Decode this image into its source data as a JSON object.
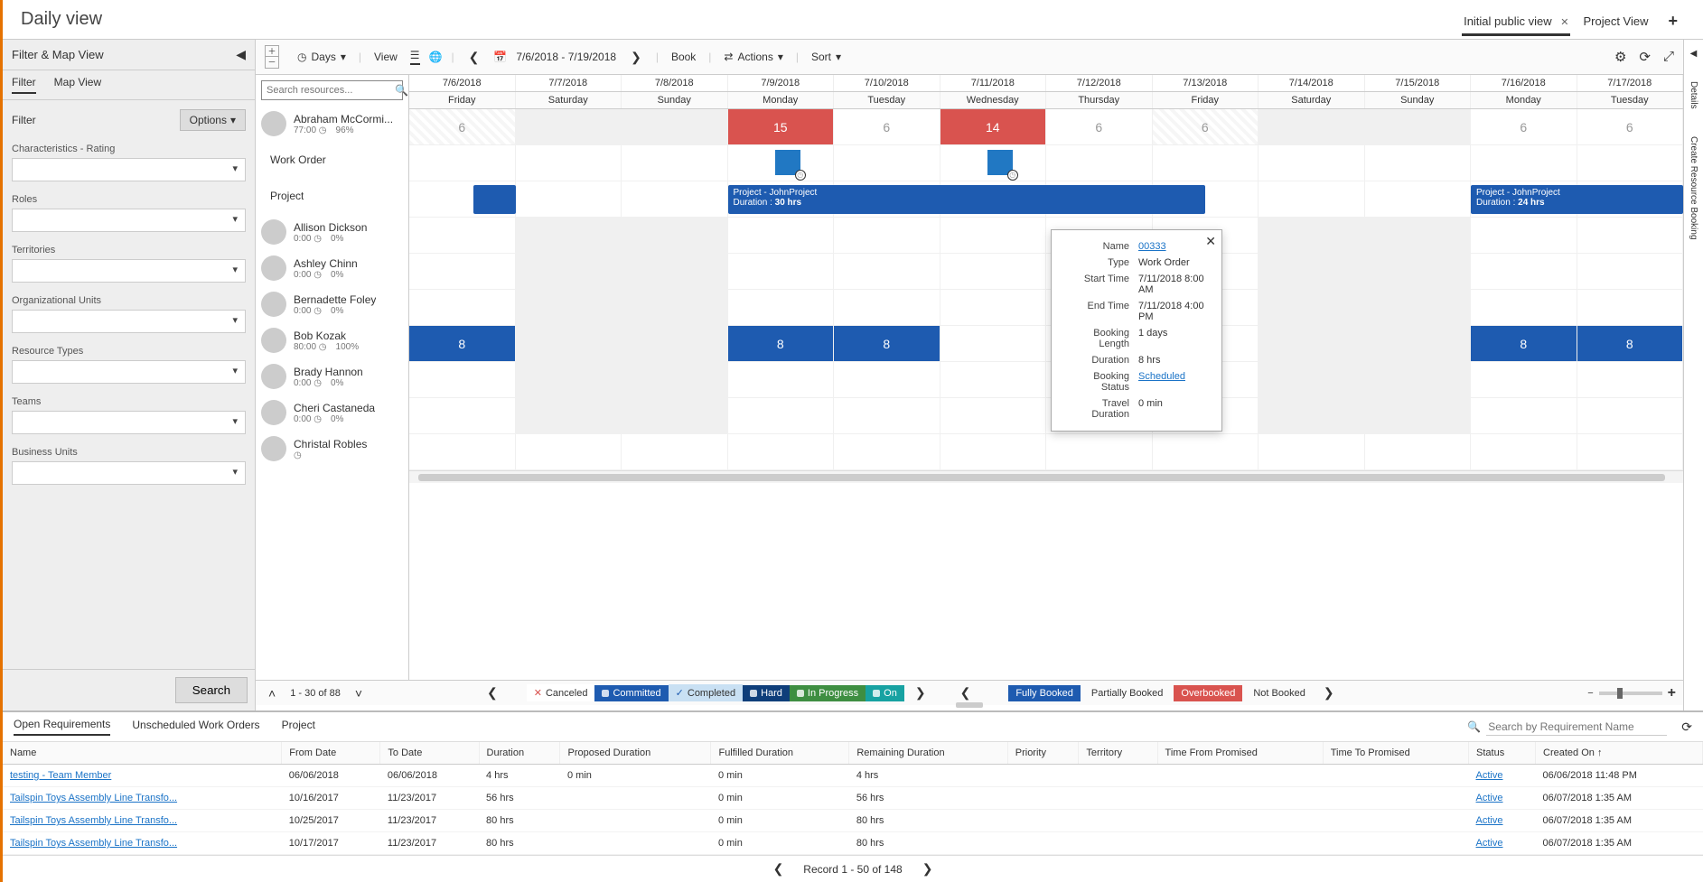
{
  "header": {
    "title": "Daily view",
    "view_tabs": [
      {
        "label": "Initial public view",
        "closable": true,
        "active": true
      },
      {
        "label": "Project View",
        "closable": false,
        "active": false
      }
    ]
  },
  "left_panel": {
    "title": "Filter & Map View",
    "tabs": [
      "Filter",
      "Map View"
    ],
    "active_tab": "Filter",
    "filter_header": "Filter",
    "options_label": "Options",
    "groups": [
      "Characteristics - Rating",
      "Roles",
      "Territories",
      "Organizational Units",
      "Resource Types",
      "Teams",
      "Business Units"
    ],
    "search_btn": "Search"
  },
  "toolbar": {
    "days": "Days",
    "view": "View",
    "date_range": "7/6/2018 - 7/19/2018",
    "book": "Book",
    "actions": "Actions",
    "sort": "Sort"
  },
  "search_placeholder": "Search resources...",
  "dates": [
    {
      "date": "7/6/2018",
      "dow": "Friday"
    },
    {
      "date": "7/7/2018",
      "dow": "Saturday"
    },
    {
      "date": "7/8/2018",
      "dow": "Sunday"
    },
    {
      "date": "7/9/2018",
      "dow": "Monday"
    },
    {
      "date": "7/10/2018",
      "dow": "Tuesday"
    },
    {
      "date": "7/11/2018",
      "dow": "Wednesday"
    },
    {
      "date": "7/12/2018",
      "dow": "Thursday"
    },
    {
      "date": "7/13/2018",
      "dow": "Friday"
    },
    {
      "date": "7/14/2018",
      "dow": "Saturday"
    },
    {
      "date": "7/15/2018",
      "dow": "Sunday"
    },
    {
      "date": "7/16/2018",
      "dow": "Monday"
    },
    {
      "date": "7/17/2018",
      "dow": "Tuesday"
    }
  ],
  "resources": [
    {
      "name": "Abraham McCormi...",
      "hours": "77:00",
      "pct": "96%",
      "expanded": true,
      "cells": [
        "6",
        "",
        "",
        "15",
        "6",
        "14",
        "6",
        "6",
        "",
        "",
        "6",
        "6"
      ],
      "cellcls": [
        "hatch",
        "gray",
        "gray",
        "red",
        "",
        "red",
        "",
        "hatch",
        "gray",
        "gray",
        "",
        ""
      ],
      "children": [
        {
          "label": "Work Order"
        },
        {
          "label": "Project"
        }
      ]
    },
    {
      "name": "Allison Dickson",
      "hours": "0:00",
      "pct": "0%",
      "cells": [
        "",
        "",
        "",
        "",
        "",
        "",
        "",
        "",
        "",
        "",
        "",
        ""
      ],
      "cellcls": [
        "",
        "gray",
        "gray",
        "",
        "",
        "",
        "",
        "",
        "gray",
        "gray",
        "",
        ""
      ]
    },
    {
      "name": "Ashley Chinn",
      "hours": "0:00",
      "pct": "0%",
      "cells": [
        "",
        "",
        "",
        "",
        "",
        "",
        "",
        "",
        "",
        "",
        "",
        ""
      ],
      "cellcls": [
        "",
        "gray",
        "gray",
        "",
        "",
        "",
        "",
        "",
        "gray",
        "gray",
        "",
        ""
      ]
    },
    {
      "name": "Bernadette Foley",
      "hours": "0:00",
      "pct": "0%",
      "cells": [
        "",
        "",
        "",
        "",
        "",
        "",
        "",
        "",
        "",
        "",
        "",
        ""
      ],
      "cellcls": [
        "",
        "gray",
        "gray",
        "",
        "",
        "",
        "",
        "",
        "gray",
        "gray",
        "",
        ""
      ]
    },
    {
      "name": "Bob Kozak",
      "hours": "80:00",
      "pct": "100%",
      "cells": [
        "8",
        "",
        "",
        "8",
        "8",
        "",
        "",
        "",
        "",
        "",
        "8",
        "8"
      ],
      "cellcls": [
        "blue",
        "gray",
        "gray",
        "blue",
        "blue",
        "",
        "",
        "",
        "gray",
        "gray",
        "blue",
        "blue"
      ]
    },
    {
      "name": "Brady Hannon",
      "hours": "0:00",
      "pct": "0%",
      "cells": [
        "",
        "",
        "",
        "",
        "",
        "",
        "",
        "",
        "",
        "",
        "",
        ""
      ],
      "cellcls": [
        "",
        "gray",
        "gray",
        "",
        "",
        "",
        "",
        "",
        "gray",
        "gray",
        "",
        ""
      ]
    },
    {
      "name": "Cheri Castaneda",
      "hours": "0:00",
      "pct": "0%",
      "cells": [
        "",
        "",
        "",
        "",
        "",
        "",
        "",
        "",
        "",
        "",
        "",
        ""
      ],
      "cellcls": [
        "",
        "gray",
        "gray",
        "",
        "",
        "",
        "",
        "",
        "gray",
        "gray",
        "",
        ""
      ]
    },
    {
      "name": "Christal Robles",
      "hours": "",
      "pct": "",
      "cells": [
        "",
        "",
        "",
        "",
        "",
        "",
        "",
        "",
        "",
        "",
        "",
        ""
      ],
      "cellcls": [
        "",
        "",
        "",
        "",
        "",
        "",
        "",
        "",
        "",
        "",
        "",
        ""
      ]
    }
  ],
  "project_bar_1": {
    "title": "Project - JohnProject",
    "duration": "30 hrs"
  },
  "project_bar_2": {
    "title": "Project - JohnProject",
    "duration": "24 hrs"
  },
  "tooltip": {
    "name_label": "Name",
    "name_val": "00333",
    "type_label": "Type",
    "type_val": "Work Order",
    "start_label": "Start Time",
    "start_val": "7/11/2018 8:00 AM",
    "end_label": "End Time",
    "end_val": "7/11/2018 4:00 PM",
    "len_label": "Booking Length",
    "len_val": "1 days",
    "dur_label": "Duration",
    "dur_val": "8 hrs",
    "status_label": "Booking Status",
    "status_val": "Scheduled",
    "travel_label": "Travel Duration",
    "travel_val": "0 min"
  },
  "pager": {
    "text": "1 - 30 of 88"
  },
  "legend_status": [
    "Canceled",
    "Committed",
    "Completed",
    "Hard",
    "In Progress",
    "On"
  ],
  "legend_book": [
    "Fully Booked",
    "Partially Booked",
    "Overbooked",
    "Not Booked"
  ],
  "rails": {
    "details": "Details",
    "create": "Create Resource Booking"
  },
  "bottom_tabs": [
    "Open Requirements",
    "Unscheduled Work Orders",
    "Project"
  ],
  "bottom_active": "Open Requirements",
  "req_search_placeholder": "Search by Requirement Name",
  "columns": [
    "Name",
    "From Date",
    "To Date",
    "Duration",
    "Proposed Duration",
    "Fulfilled Duration",
    "Remaining Duration",
    "Priority",
    "Territory",
    "Time From Promised",
    "Time To Promised",
    "Status",
    "Created On ↑"
  ],
  "rows": [
    {
      "name": "testing - Team Member",
      "from": "06/06/2018",
      "to": "06/06/2018",
      "dur": "4 hrs",
      "prop": "0 min",
      "ful": "0 min",
      "rem": "4 hrs",
      "status": "Active",
      "created": "06/06/2018 11:48 PM"
    },
    {
      "name": "Tailspin Toys Assembly Line Transfo...",
      "from": "10/16/2017",
      "to": "11/23/2017",
      "dur": "56 hrs",
      "prop": "",
      "ful": "0 min",
      "rem": "56 hrs",
      "status": "Active",
      "created": "06/07/2018 1:35 AM"
    },
    {
      "name": "Tailspin Toys Assembly Line Transfo...",
      "from": "10/25/2017",
      "to": "11/23/2017",
      "dur": "80 hrs",
      "prop": "",
      "ful": "0 min",
      "rem": "80 hrs",
      "status": "Active",
      "created": "06/07/2018 1:35 AM"
    },
    {
      "name": "Tailspin Toys Assembly Line Transfo...",
      "from": "10/17/2017",
      "to": "11/23/2017",
      "dur": "80 hrs",
      "prop": "",
      "ful": "0 min",
      "rem": "80 hrs",
      "status": "Active",
      "created": "06/07/2018 1:35 AM"
    }
  ],
  "bottom_pager": "Record 1 - 50 of 148"
}
